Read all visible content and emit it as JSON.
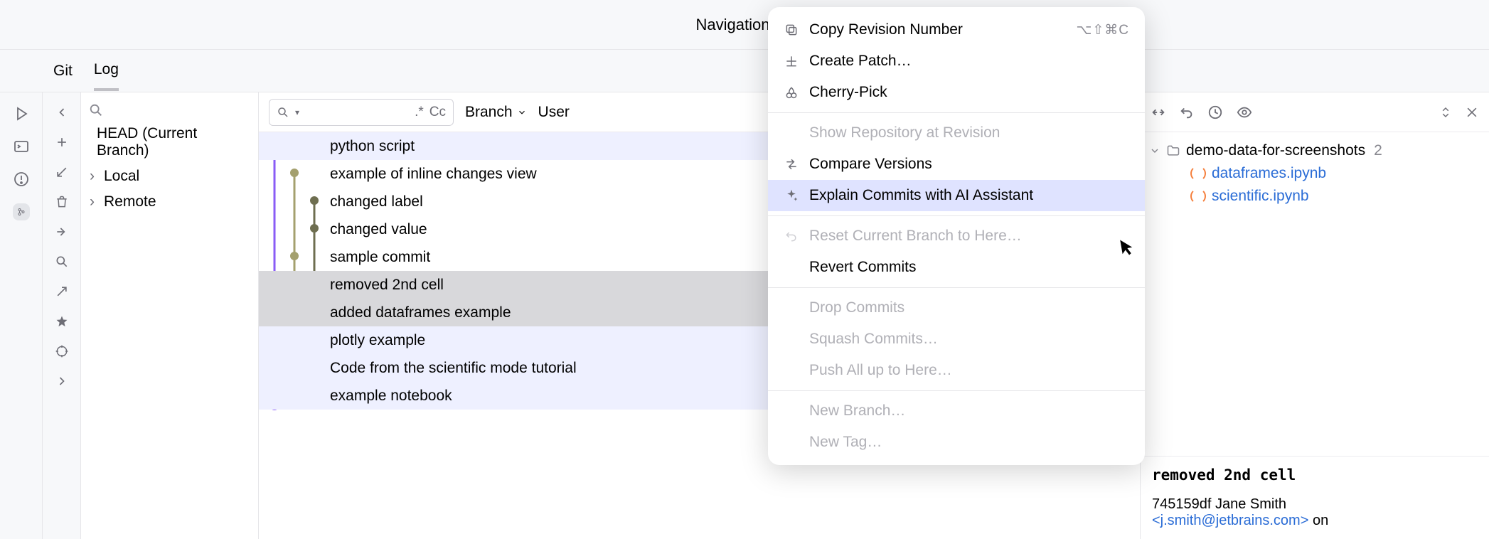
{
  "header": {
    "title": "Navigation Ba"
  },
  "tabs": {
    "git": "Git",
    "log": "Log"
  },
  "branch_panel": {
    "head": "HEAD (Current Branch)",
    "local": "Local",
    "remote": "Remote"
  },
  "filters": {
    "regex": ".*",
    "cc": "Cc",
    "branch": "Branch",
    "user": "User"
  },
  "commits": [
    "python script",
    "example of inline changes view",
    "changed label",
    "changed value",
    "sample commit",
    "removed 2nd cell",
    "added dataframes example",
    "plotly example",
    "Code from the scientific mode tutorial",
    "example notebook"
  ],
  "context_menu": {
    "copy_rev": "Copy Revision Number",
    "copy_rev_shortcut": "⌥⇧⌘C",
    "create_patch": "Create Patch…",
    "cherry_pick": "Cherry-Pick",
    "show_repo": "Show Repository at Revision",
    "compare": "Compare Versions",
    "explain_ai": "Explain Commits with AI Assistant",
    "reset_branch": "Reset Current Branch to Here…",
    "revert": "Revert Commits",
    "drop": "Drop Commits",
    "squash": "Squash Commits…",
    "push_all": "Push All up to Here…",
    "new_branch": "New Branch…",
    "new_tag": "New Tag…"
  },
  "files": {
    "folder": "demo-data-for-screenshots",
    "count": "2",
    "f1": "dataframes.ipynb",
    "f2": "scientific.ipynb"
  },
  "detail": {
    "title": "removed 2nd cell",
    "hash_author": "745159df Jane Smith",
    "email": "<j.smith@jetbrains.com>",
    "on": " on"
  }
}
